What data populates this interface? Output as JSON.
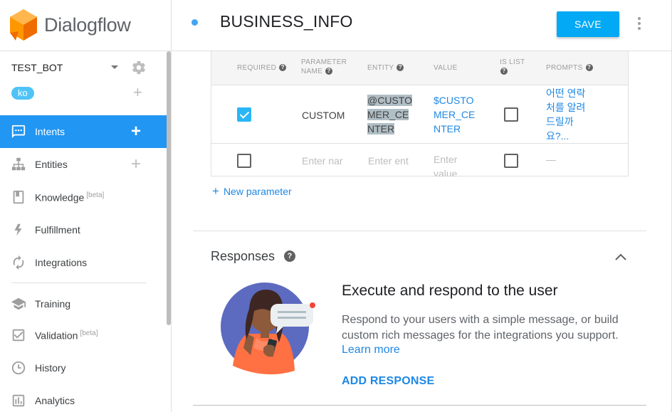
{
  "app": {
    "brand_name": "Dialogflow",
    "colors": {
      "accent": "#2196f3",
      "save": "#03a9f4",
      "chip": "#4fc3f7"
    }
  },
  "sidebar": {
    "agent_name": "TEST_BOT",
    "language_chip": "ko",
    "nav_items": [
      {
        "label": "Intents",
        "icon": "intents-icon"
      },
      {
        "label": "Entities",
        "icon": "entities-icon"
      },
      {
        "label": "Knowledge",
        "icon": "knowledge-icon",
        "badge": "[beta]"
      },
      {
        "label": "Fulfillment",
        "icon": "fulfillment-icon"
      },
      {
        "label": "Integrations",
        "icon": "integrations-icon"
      },
      {
        "label": "Training",
        "icon": "training-icon"
      },
      {
        "label": "Validation",
        "icon": "validation-icon",
        "badge": "[beta]"
      },
      {
        "label": "History",
        "icon": "history-icon"
      },
      {
        "label": "Analytics",
        "icon": "analytics-icon"
      }
    ]
  },
  "header": {
    "intent_name": "BUSINESS_INFO",
    "save_label": "SAVE"
  },
  "parameters": {
    "columns": {
      "required": "REQUIRED",
      "parameter_name_1": "PARAMETER",
      "parameter_name_2": "NAME",
      "entity": "ENTITY",
      "value": "VALUE",
      "is_list": "IS LIST",
      "prompts": "PROMPTS"
    },
    "rows": [
      {
        "required": true,
        "name": "CUSTOM",
        "entity": "@CUSTOMER_CENTER",
        "value": "$CUSTOMER_CENTER",
        "is_list": false,
        "prompts": "어떤 연락처를 알려드릴까요?..."
      }
    ],
    "empty_row": {
      "required": false,
      "name_placeholder": "Enter nar",
      "entity_placeholder": "Enter ent",
      "value_placeholder": "Enter value",
      "is_list": false,
      "prompts_placeholder": "—"
    },
    "new_parameter_label": "New parameter"
  },
  "responses": {
    "title": "Responses",
    "heading": "Execute and respond to the user",
    "description": "Respond to your users with a simple message, or build custom rich messages for the integrations you support.",
    "learn_more": "Learn more",
    "add_response": "ADD RESPONSE"
  }
}
